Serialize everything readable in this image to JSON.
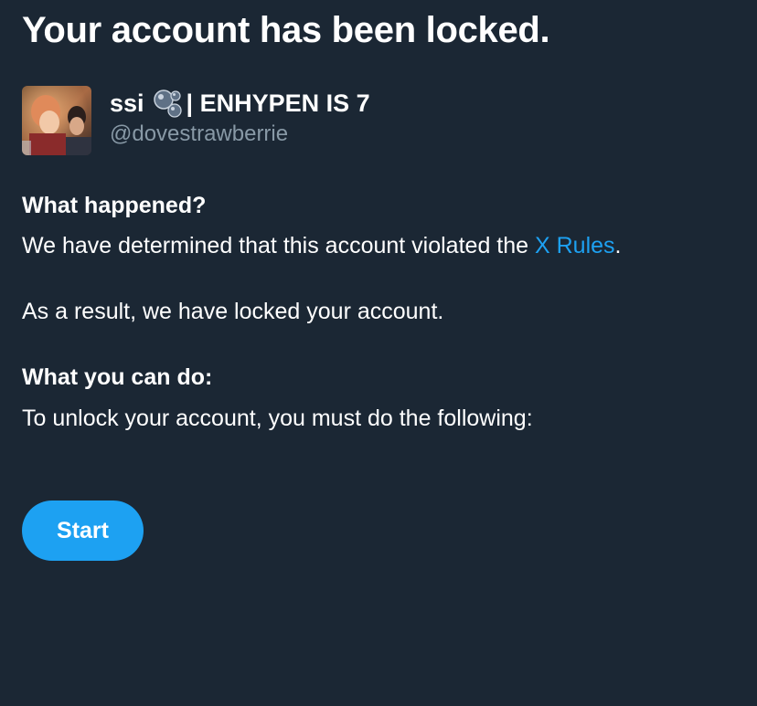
{
  "header": {
    "title": "Your account has been locked."
  },
  "profile": {
    "display_name_prefix": "ssi",
    "display_name_suffix": "| ENHYPEN IS 7",
    "name_emoji_icon": "bubbles-icon",
    "handle": "@dovestrawberrie"
  },
  "what_happened": {
    "heading": "What happened?",
    "text_before_link": "We have determined that this account violated the ",
    "link_text": "X Rules",
    "text_after_link": ".",
    "result_text": "As a result, we have locked your account."
  },
  "what_you_can_do": {
    "heading": "What you can do:",
    "text": "To unlock your account, you must do the following:"
  },
  "actions": {
    "start_label": "Start"
  },
  "colors": {
    "background": "#1b2734",
    "accent": "#1da1f2",
    "secondary_text": "#8899a6",
    "primary_text": "#ffffff"
  }
}
